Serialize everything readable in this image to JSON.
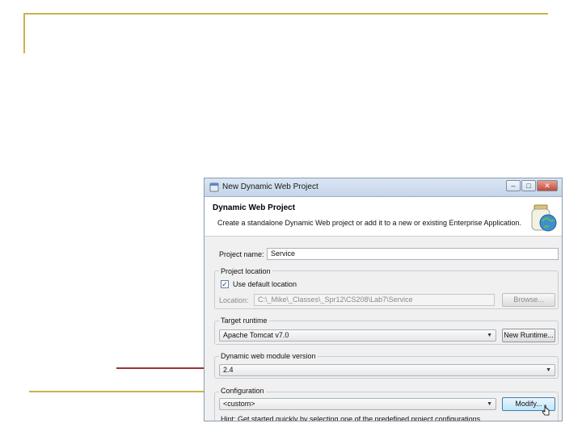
{
  "dialog": {
    "title": "New Dynamic Web Project",
    "header": {
      "title": "Dynamic Web Project",
      "description": "Create a standalone Dynamic Web project or add it to a new or existing Enterprise Application."
    },
    "project_name": {
      "label": "Project name:",
      "value": "Service"
    },
    "project_location": {
      "group_label": "Project location",
      "use_default": {
        "label": "Use default location",
        "checked": true
      },
      "location_label": "Location:",
      "location_value": "C:\\_Mike\\_Classes\\_Spr12\\CS208\\Lab7\\Service",
      "browse_label": "Browse..."
    },
    "target_runtime": {
      "group_label": "Target runtime",
      "value": "Apache Tomcat v7.0",
      "new_runtime_label": "New Runtime..."
    },
    "module_version": {
      "group_label": "Dynamic web module version",
      "value": "2.4"
    },
    "configuration": {
      "group_label": "Configuration",
      "value": "<custom>",
      "modify_label": "Modify...",
      "hint": "Hint: Get started quickly by selecting one of the predefined project configurations."
    },
    "window_buttons": {
      "minimize": "–",
      "maximize": "□",
      "close": "✕"
    }
  },
  "colors": {
    "slide_accent": "#c8b44a",
    "arrow": "#a03030",
    "titlebar": "#c4d5ea"
  }
}
